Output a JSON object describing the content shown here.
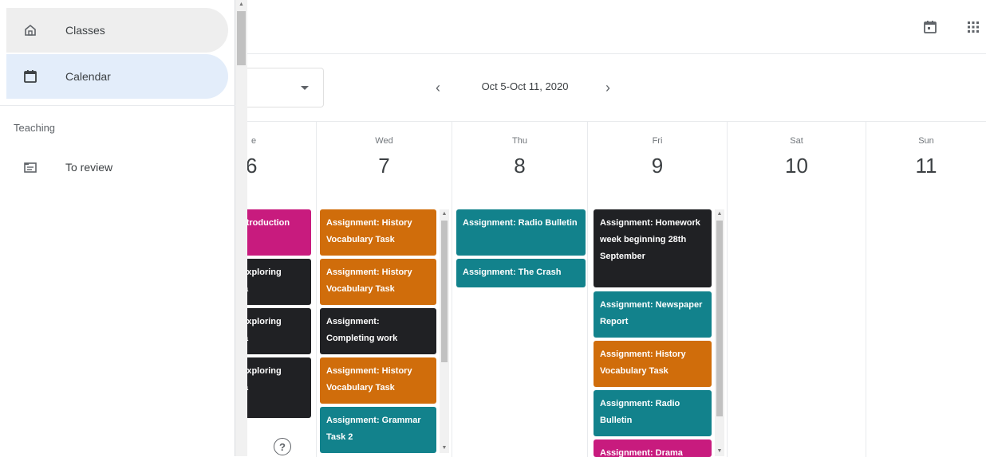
{
  "drawer": {
    "items": [
      {
        "label": "Classes",
        "icon": "home-icon"
      },
      {
        "label": "Calendar",
        "icon": "calendar-icon"
      }
    ],
    "section_label": "Teaching",
    "to_review": {
      "label": "To review",
      "icon": "inbox-icon"
    }
  },
  "toolbar": {
    "week_range": "Oct 5-Oct 11, 2020",
    "prev": "‹",
    "next": "›"
  },
  "days": [
    {
      "name": "e",
      "num": "6"
    },
    {
      "name": "Wed",
      "num": "7"
    },
    {
      "name": "Thu",
      "num": "8"
    },
    {
      "name": "Fri",
      "num": "9"
    },
    {
      "name": "Sat",
      "num": "10"
    },
    {
      "name": "Sun",
      "num": "11"
    }
  ],
  "tue_cards": [
    "ntroduction",
    "Exploring\nia",
    "Exploring\nia",
    "Exploring\nia"
  ],
  "wed_cards": [
    "Assignment: History Vocabulary Task",
    "Assignment: History Vocabulary Task",
    "Assignment: Completing work",
    "Assignment: History Vocabulary Task",
    "Assignment: Grammar Task 2"
  ],
  "thu_cards": [
    "Assignment: Radio Bulletin",
    "Assignment: The Crash"
  ],
  "fri_cards": [
    "Assignment: Homework week beginning 28th September",
    "Assignment: Newspaper Report",
    "Assignment: History Vocabulary Task",
    "Assignment: Radio Bulletin",
    "Assignment: Drama"
  ],
  "colors": {
    "orange": "#d06d0b",
    "teal": "#12828c",
    "black": "#202124",
    "pink": "#c81b7e",
    "active_nav": "#e3edfa"
  },
  "icons": {
    "top_calendar": "calendar-icon",
    "top_apps": "apps-grid-icon",
    "help": "?"
  }
}
